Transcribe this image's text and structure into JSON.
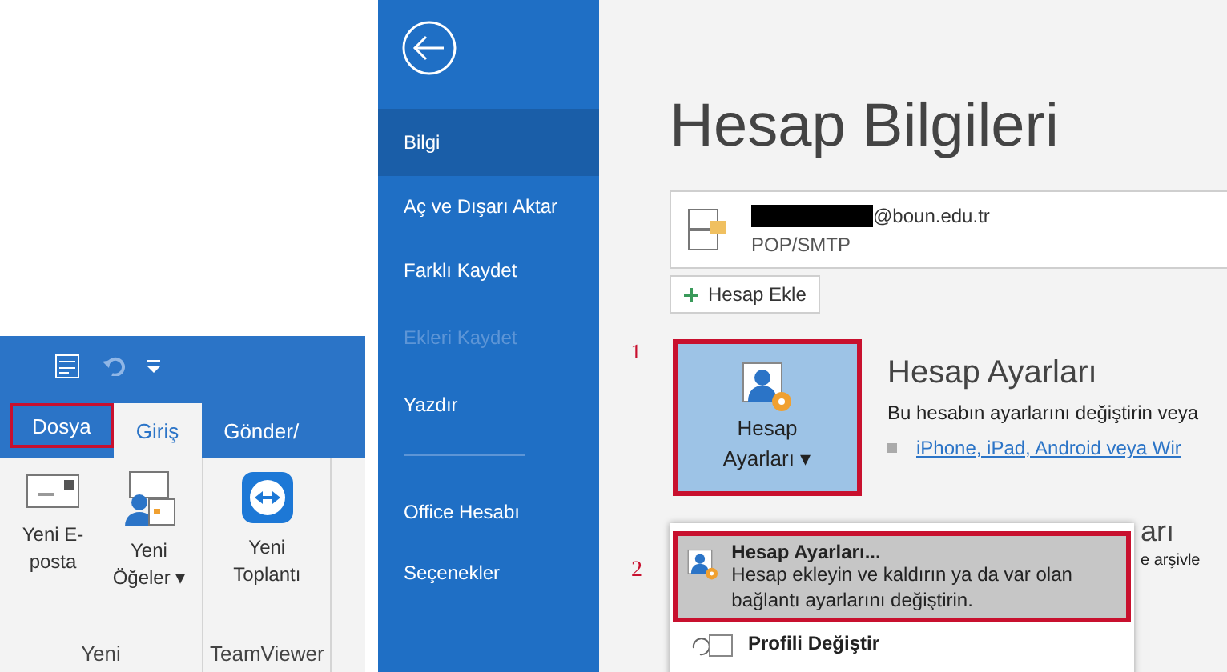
{
  "ribbon": {
    "tabs": [
      {
        "label": "Dosya",
        "selected": false,
        "marked": true
      },
      {
        "label": "Giriş",
        "selected": true,
        "marked": false
      },
      {
        "label": "Gönder/",
        "selected": false,
        "marked": false
      }
    ],
    "groups": [
      {
        "name": "Yeni",
        "buttons": [
          {
            "kind": "mail",
            "lines": [
              "Yeni E-",
              "posta"
            ]
          },
          {
            "kind": "items",
            "lines": [
              "Yeni",
              "Öğeler"
            ],
            "caret": "▾"
          }
        ]
      },
      {
        "name": "TeamViewer",
        "buttons": [
          {
            "kind": "meeting",
            "lines": [
              "Yeni",
              "Toplantı"
            ]
          }
        ]
      }
    ]
  },
  "sidebar": {
    "items": [
      {
        "label": "Bilgi",
        "selected": true,
        "disabled": false
      },
      {
        "label": "Aç ve Dışarı Aktar",
        "selected": false,
        "disabled": false
      },
      {
        "label": "Farklı Kaydet",
        "selected": false,
        "disabled": false
      },
      {
        "label": "Ekleri Kaydet",
        "selected": false,
        "disabled": true
      },
      {
        "label": "Yazdır",
        "selected": false,
        "disabled": false
      }
    ],
    "footer_items": [
      {
        "label": "Office Hesabı",
        "selected": false,
        "disabled": false
      },
      {
        "label": "Seçenekler",
        "selected": false,
        "disabled": false
      }
    ]
  },
  "content": {
    "title": "Hesap Bilgileri",
    "account": {
      "email": "@boun.edu.tr",
      "type": "POP/SMTP"
    },
    "add_account": "Hesap Ekle",
    "settings": {
      "marker": "1",
      "button_lines": [
        "Hesap",
        "Ayarları"
      ],
      "button_caret": "▾",
      "heading": "Hesap Ayarları",
      "description": "Bu hesabın ayarlarını değiştirin veya",
      "link": "iPhone, iPad, Android veya Wir"
    },
    "hidden_section": {
      "heading": "arı",
      "text": "e arşivle"
    },
    "menu": {
      "marker": "2",
      "items": [
        {
          "title": "Hesap Ayarları...",
          "description": "Hesap ekleyin ve kaldırın ya da var olan bağlantı ayarlarını değiştirin.",
          "selected": true
        },
        {
          "title": "Profili Değiştir",
          "selected": false
        }
      ]
    }
  }
}
